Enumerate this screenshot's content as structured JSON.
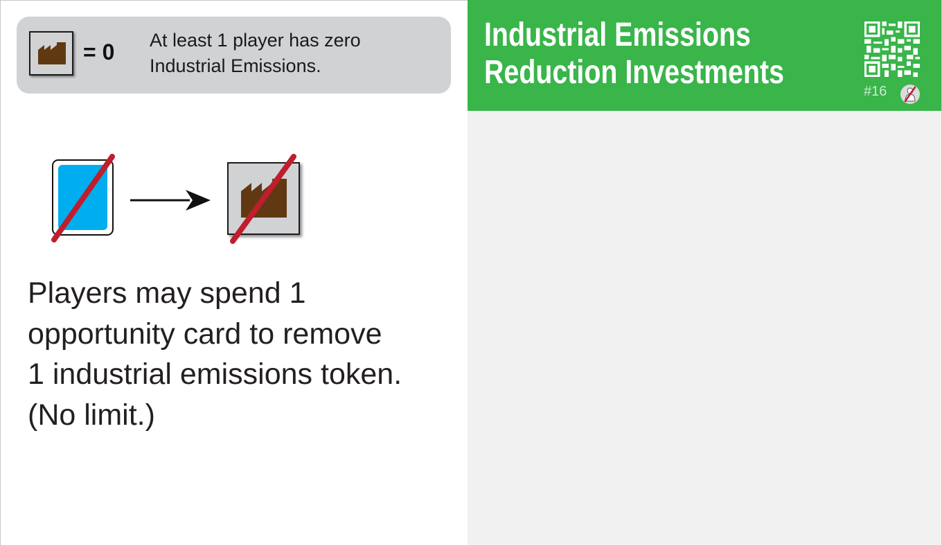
{
  "condition": {
    "equals_label": "= 0",
    "text_line1": "At least 1 player has zero",
    "text_line2": "Industrial Emissions."
  },
  "effect": {
    "line1": "Players may spend 1",
    "line2": "opportunity card to remove",
    "line3": "1 industrial emissions token.",
    "line4": "(No limit.)"
  },
  "title": {
    "line1": "Industrial Emissions",
    "line2": "Reduction Investments"
  },
  "card_number": "#16",
  "icons": [
    "factory-icon",
    "opportunity-card-icon",
    "arrow-right-icon",
    "qr-code-icon",
    "no-player-icon"
  ],
  "colors": {
    "title_bar": "#39b54a",
    "condition_box": "#d1d2d4",
    "card_blue": "#00adef",
    "factory_brown": "#603913",
    "strike_red": "#be1e2d",
    "right_panel": "#f1f1f1"
  }
}
